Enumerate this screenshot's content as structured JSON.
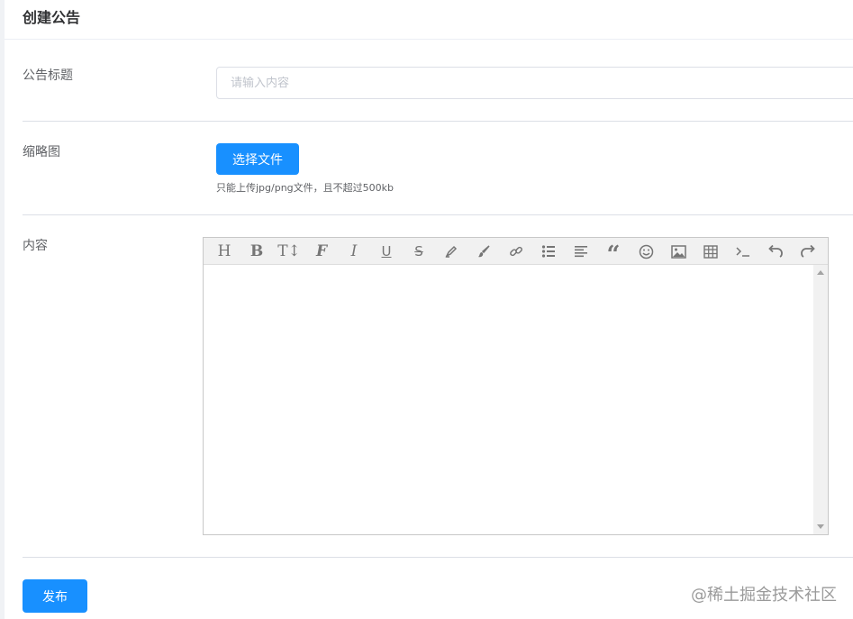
{
  "header": {
    "title": "创建公告"
  },
  "form": {
    "title_label": "公告标题",
    "title_placeholder": "请输入内容",
    "title_value": "",
    "thumbnail_label": "缩略图",
    "choose_file_label": "选择文件",
    "upload_tip": "只能上传jpg/png文件，且不超过500kb",
    "content_label": "内容"
  },
  "editor": {
    "toolbar": [
      {
        "icon": "heading-icon"
      },
      {
        "icon": "bold-icon"
      },
      {
        "icon": "font-size-icon"
      },
      {
        "icon": "font-family-icon"
      },
      {
        "icon": "italic-icon"
      },
      {
        "icon": "underline-icon"
      },
      {
        "icon": "strikethrough-icon"
      },
      {
        "icon": "text-color-icon"
      },
      {
        "icon": "background-color-icon"
      },
      {
        "icon": "link-icon"
      },
      {
        "icon": "list-icon"
      },
      {
        "icon": "justify-icon"
      },
      {
        "icon": "quote-icon"
      },
      {
        "icon": "emoticon-icon"
      },
      {
        "icon": "image-icon"
      },
      {
        "icon": "table-icon"
      },
      {
        "icon": "code-icon"
      },
      {
        "icon": "undo-icon"
      },
      {
        "icon": "redo-icon"
      }
    ]
  },
  "actions": {
    "publish_label": "发布"
  },
  "watermark": {
    "text": "@稀土掘金技术社区"
  },
  "colors": {
    "primary": "#1890ff",
    "border": "#dcdfe6",
    "toolbar_bg": "#f1f1f1",
    "icon": "#757575"
  }
}
